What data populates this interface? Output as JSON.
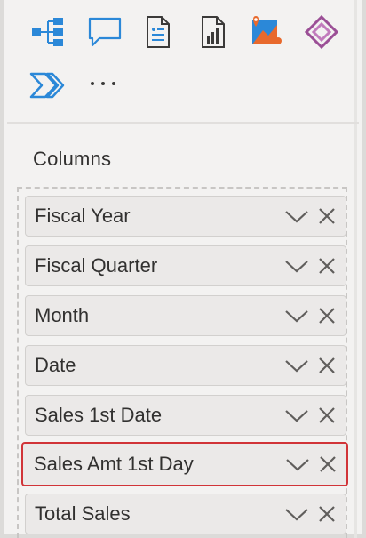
{
  "toolbar": {
    "icons": [
      {
        "name": "decomposition-tree-icon",
        "color": "#2b88d8"
      },
      {
        "name": "qna-icon",
        "color": "#2b88d8"
      },
      {
        "name": "smart-narrative-icon",
        "color": "#2b88d8"
      },
      {
        "name": "paginated-report-icon",
        "color": "#3b3a39"
      },
      {
        "name": "azure-map-icon",
        "color": "#e8692c"
      },
      {
        "name": "power-apps-icon",
        "color": "#9b4f96"
      },
      {
        "name": "power-automate-icon",
        "color": "#2b88d8"
      },
      {
        "name": "more-icon",
        "color": "#3b3a39"
      }
    ],
    "more_label": "···"
  },
  "columns_section": {
    "label": "Columns",
    "fields": [
      {
        "label": "Fiscal Year"
      },
      {
        "label": "Fiscal Quarter"
      },
      {
        "label": "Month"
      },
      {
        "label": "Date"
      },
      {
        "label": "Sales 1st Date"
      },
      {
        "label": "Sales Amt 1st Day",
        "highlighted": true
      },
      {
        "label": "Total Sales"
      }
    ]
  },
  "colors": {
    "highlight_border": "#d13438",
    "field_bg": "#ebe9e8",
    "pane_bg": "#f3f2f1"
  }
}
